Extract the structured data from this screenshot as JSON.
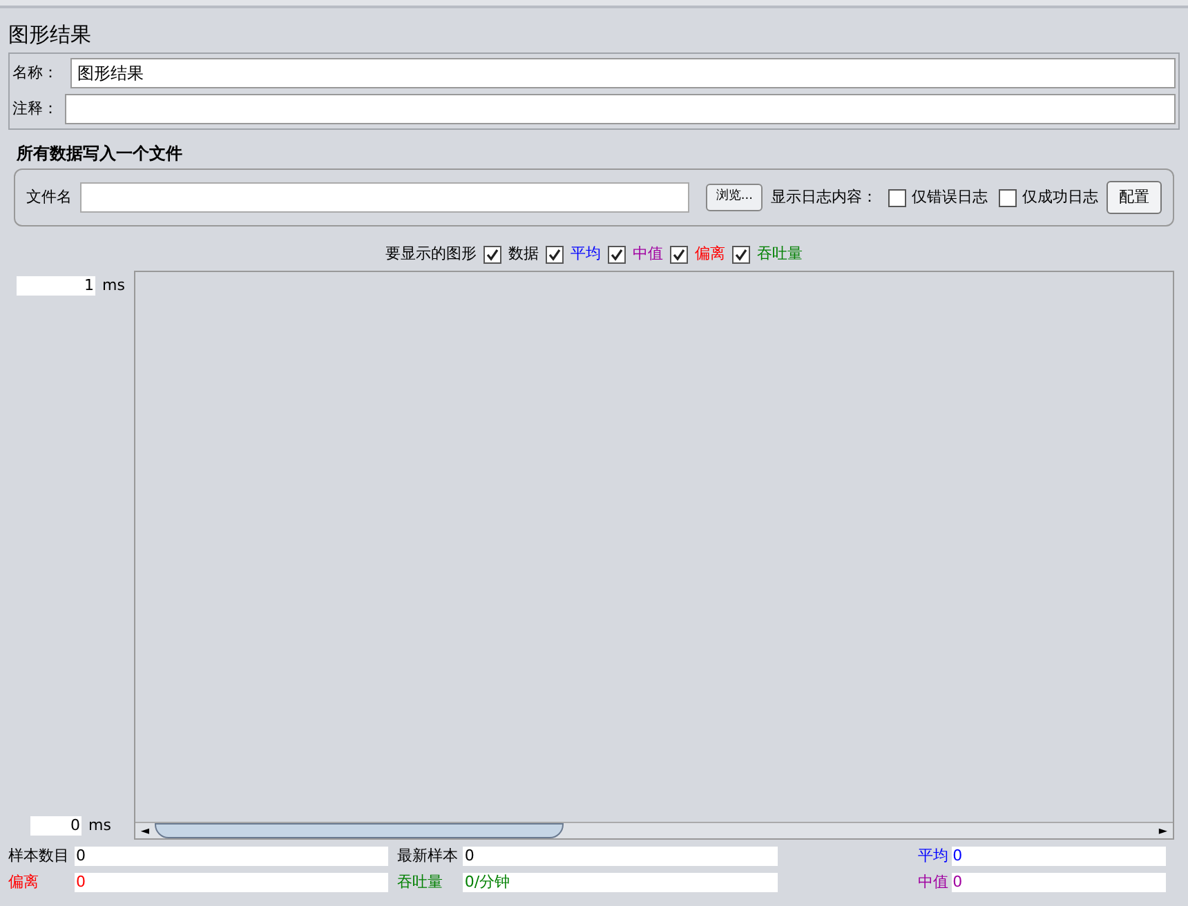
{
  "title": "图形结果",
  "name_field": {
    "label": "名称：",
    "value": "图形结果"
  },
  "comment_field": {
    "label": "注释："
  },
  "file_section": {
    "title": "所有数据写入一个文件",
    "file_label": "文件名",
    "browse_button": "浏览...",
    "log_label": "显示日志内容：",
    "options": [
      {
        "label": "仅错误日志",
        "checked": false
      },
      {
        "label": "仅成功日志",
        "checked": false
      }
    ],
    "config_button": "配置"
  },
  "legend": {
    "label": "要显示的图形",
    "items": [
      {
        "label": "数据",
        "checked": true,
        "color": "#000000"
      },
      {
        "label": "平均",
        "checked": true,
        "color": "#0000ff"
      },
      {
        "label": "中值",
        "checked": true,
        "color": "#a000a0"
      },
      {
        "label": "偏离",
        "checked": true,
        "color": "#ff0000"
      },
      {
        "label": "吞吐量",
        "checked": true,
        "color": "#008000"
      }
    ]
  },
  "y_axis": {
    "max": "1",
    "min": "0",
    "unit_top": "ms",
    "unit_bottom": "ms"
  },
  "scrollbar": {
    "left": "◄",
    "right": "►"
  },
  "stats": [
    {
      "label": "样本数目",
      "value": "0",
      "color": "#000000"
    },
    {
      "label": "最新样本",
      "value": "0",
      "color": "#000000"
    },
    {
      "label": "平均",
      "value": "0",
      "color": "#0000ff"
    },
    {
      "label": "偏离",
      "value": "0",
      "color": "#ff0000"
    },
    {
      "label": "吞吐量",
      "value": "0/分钟",
      "color": "#008000"
    },
    {
      "label": "中值",
      "value": "0",
      "color": "#a000a0"
    }
  ]
}
